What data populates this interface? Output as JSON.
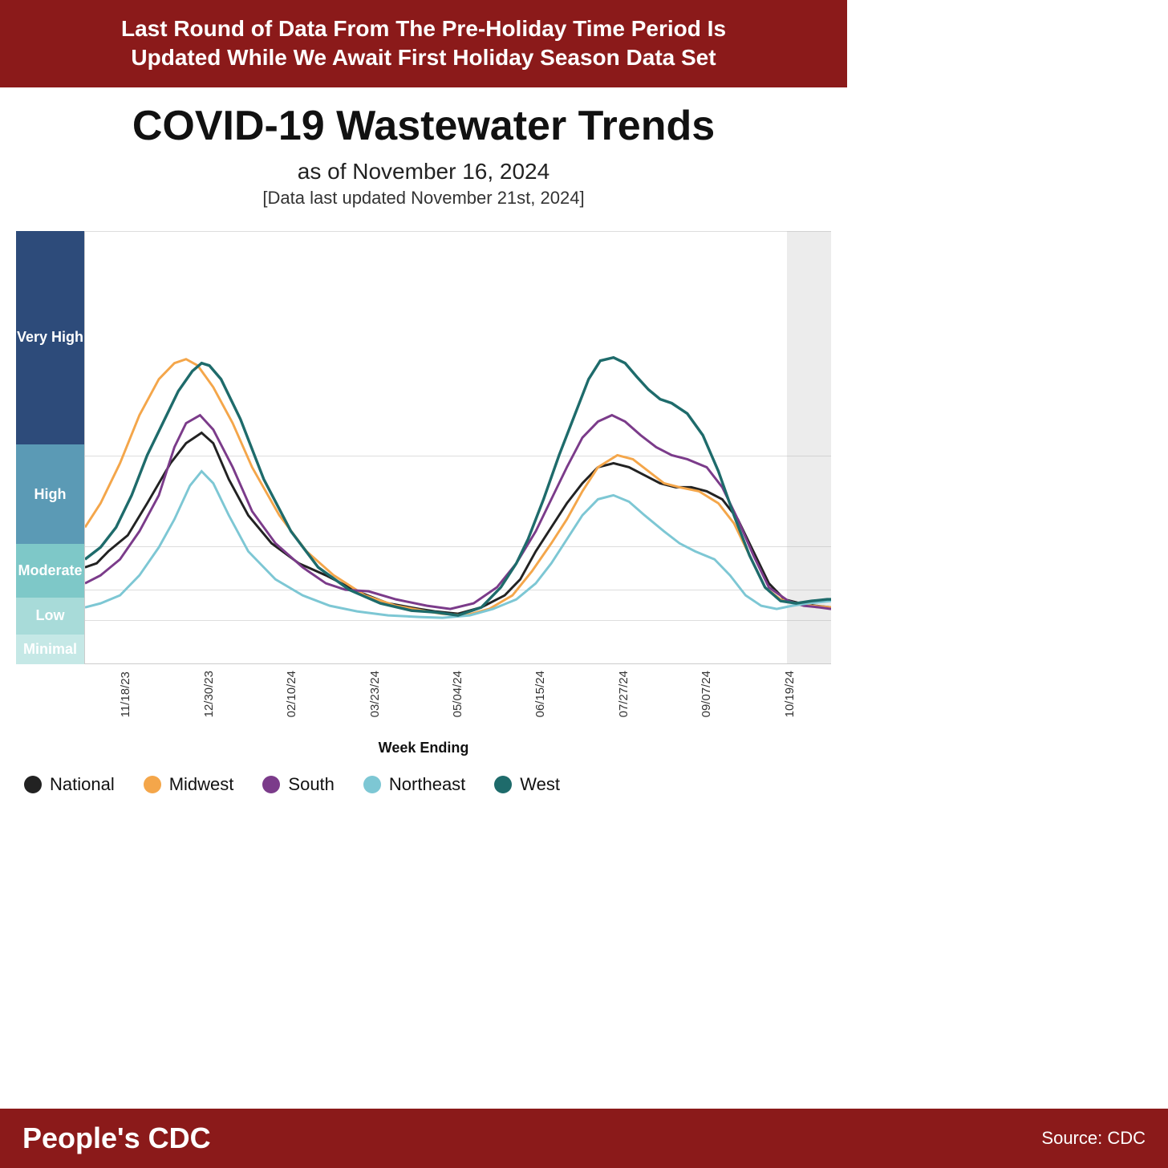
{
  "header": {
    "line1": "Last Round of Data From The Pre-Holiday Time Period Is",
    "line2": "Updated While We Await First Holiday Season Data Set"
  },
  "title": "COVID-19 Wastewater Trends",
  "date_line": "as of November 16, 2024",
  "update_line": "[Data last updated November 21st, 2024]",
  "y_labels": {
    "very_high": "Very High",
    "high": "High",
    "moderate": "Moderate",
    "low": "Low",
    "minimal": "Minimal"
  },
  "x_ticks": [
    "11/18/23",
    "12/30/23",
    "02/10/24",
    "03/23/24",
    "05/04/24",
    "06/15/24",
    "07/27/24",
    "09/07/24",
    "10/19/24"
  ],
  "x_axis_label": "Week Ending",
  "legend": [
    {
      "label": "National",
      "color": "#222222"
    },
    {
      "label": "Midwest",
      "color": "#f4a64a"
    },
    {
      "label": "South",
      "color": "#7b3b8a"
    },
    {
      "label": "Northeast",
      "color": "#7dc7d4"
    },
    {
      "label": "West",
      "color": "#1e6b6b"
    }
  ],
  "footer": {
    "brand": "People's CDC",
    "source": "Source: CDC"
  },
  "colors": {
    "header_bg": "#8B1A1A",
    "very_high_bg": "#2d4b7a",
    "high_bg": "#5b9ab5",
    "moderate_bg": "#7ec8c8",
    "low_bg": "#a8dbd9",
    "minimal_bg": "#c5e8e6"
  }
}
